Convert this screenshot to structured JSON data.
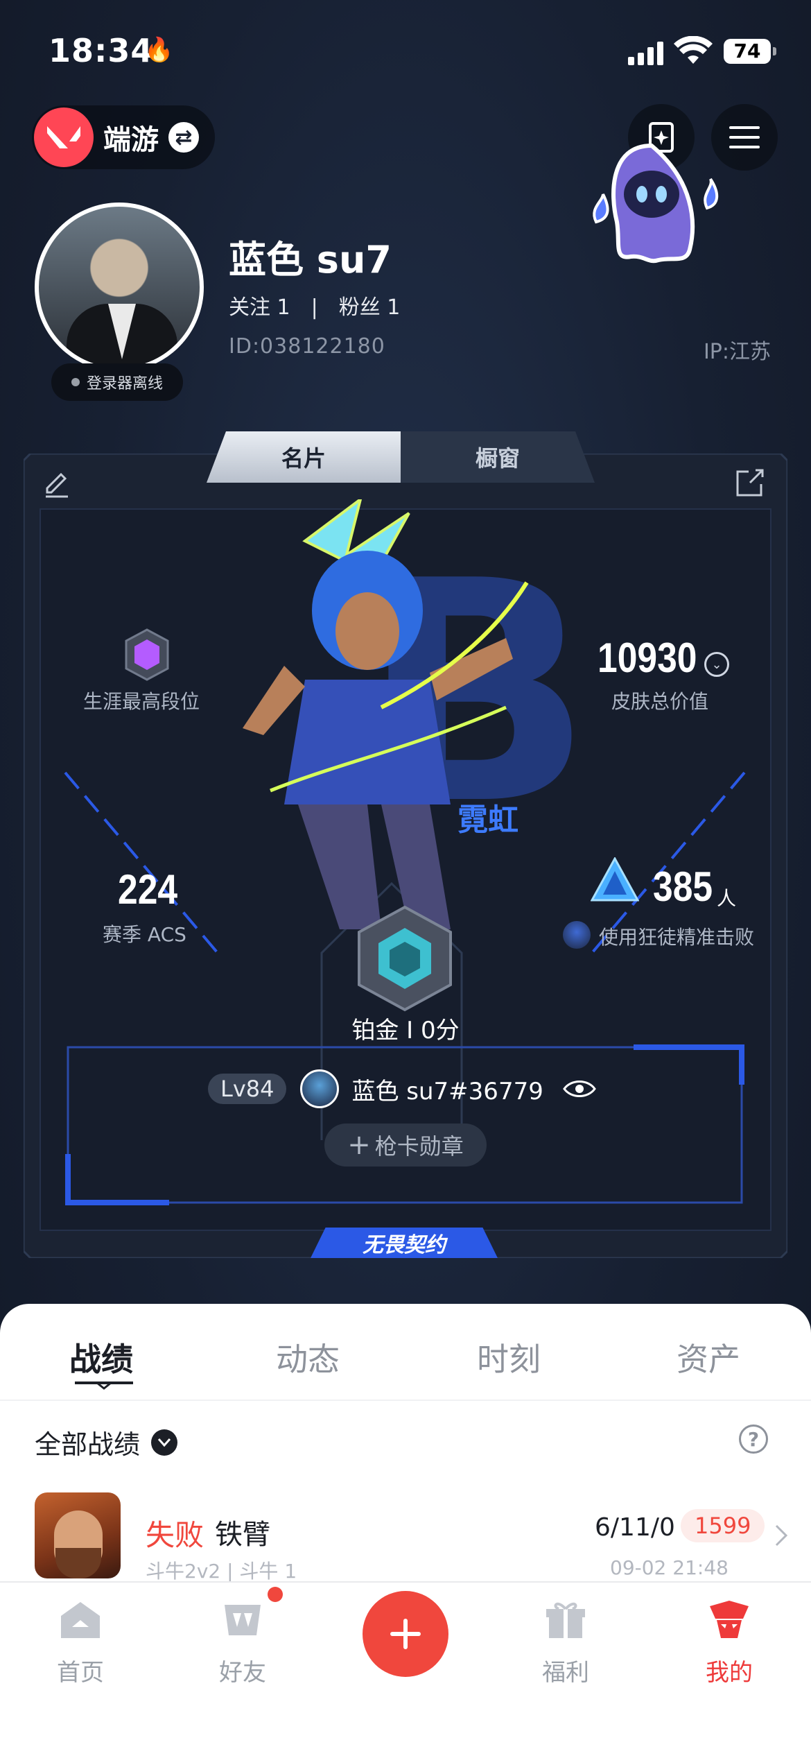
{
  "status_bar": {
    "time": "18:34",
    "battery": "74"
  },
  "header": {
    "game_name": "端游"
  },
  "profile": {
    "nickname": "蓝色 su7",
    "following_label": "关注",
    "following_count": "1",
    "followers_label": "粉丝",
    "followers_count": "1",
    "uid": "ID:038122180",
    "ip": "IP:江苏",
    "status": "登录器离线"
  },
  "card_tabs": [
    {
      "label": "名片"
    },
    {
      "label": "橱窗"
    }
  ],
  "card": {
    "career_rank_label": "生涯最高段位",
    "skin_value": "10930",
    "skin_value_label": "皮肤总价值",
    "agent_name": "霓虹",
    "season_acs": "224",
    "season_acs_label": "赛季 ACS",
    "kills": "385",
    "kills_unit": "人",
    "kills_label": "使用狂徒精准击败",
    "rank": "铂金 I 0分",
    "level": "Lv84",
    "riot_id": "蓝色 su7#36779",
    "medal_button": "枪卡勋章",
    "contract_tag": "无畏契约"
  },
  "main_tabs": [
    {
      "label": "战绩"
    },
    {
      "label": "动态"
    },
    {
      "label": "时刻"
    },
    {
      "label": "资产"
    }
  ],
  "filter": {
    "label": "全部战绩"
  },
  "matches": [
    {
      "result": "失败",
      "agent": "铁臂",
      "mode": "斗牛2v2 | 斗牛 1",
      "kda": "6/11/0",
      "score": "1599",
      "time": "09-02 21:48"
    }
  ],
  "nav": [
    {
      "label": "首页"
    },
    {
      "label": "好友"
    },
    {
      "label": "福利"
    },
    {
      "label": "我的"
    }
  ],
  "colors": {
    "accent": "#f0473d",
    "card_blue": "#2b59e6",
    "sheet_bg": "#ffffff"
  }
}
